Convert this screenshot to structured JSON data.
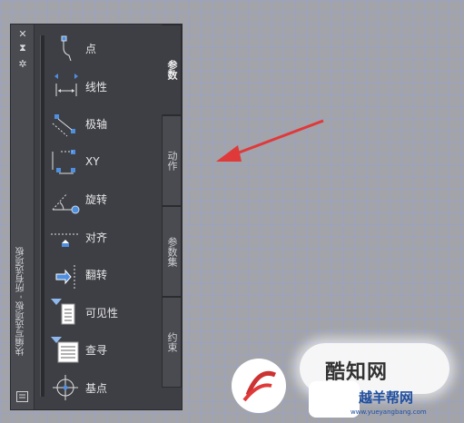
{
  "palette": {
    "title": "块编写选项板 - 所有选项板",
    "close_glyph": "✕",
    "autohide_glyph": "⧗",
    "properties_glyph": "✲",
    "tools": [
      {
        "label": "点",
        "icon": "point-parameter-icon"
      },
      {
        "label": "线性",
        "icon": "linear-parameter-icon"
      },
      {
        "label": "极轴",
        "icon": "polar-parameter-icon"
      },
      {
        "label": "XY",
        "icon": "xy-parameter-icon"
      },
      {
        "label": "旋转",
        "icon": "rotation-parameter-icon"
      },
      {
        "label": "对齐",
        "icon": "alignment-parameter-icon"
      },
      {
        "label": "翻转",
        "icon": "flip-parameter-icon"
      },
      {
        "label": "可见性",
        "icon": "visibility-parameter-icon"
      },
      {
        "label": "查寻",
        "icon": "lookup-parameter-icon"
      },
      {
        "label": "基点",
        "icon": "basepoint-parameter-icon"
      }
    ],
    "tabs": [
      {
        "label": "参数",
        "active": true
      },
      {
        "label": "动作",
        "active": false
      },
      {
        "label": "参数集",
        "active": false
      },
      {
        "label": "约束",
        "active": false
      }
    ]
  },
  "watermark": {
    "brand": "酷知网",
    "sub": "越羊帮网",
    "url": "www.yueyangbang.com"
  },
  "colors": {
    "arrow": "#e0393a",
    "panel": "#3e3f44",
    "accent": "#4f8fe0"
  }
}
